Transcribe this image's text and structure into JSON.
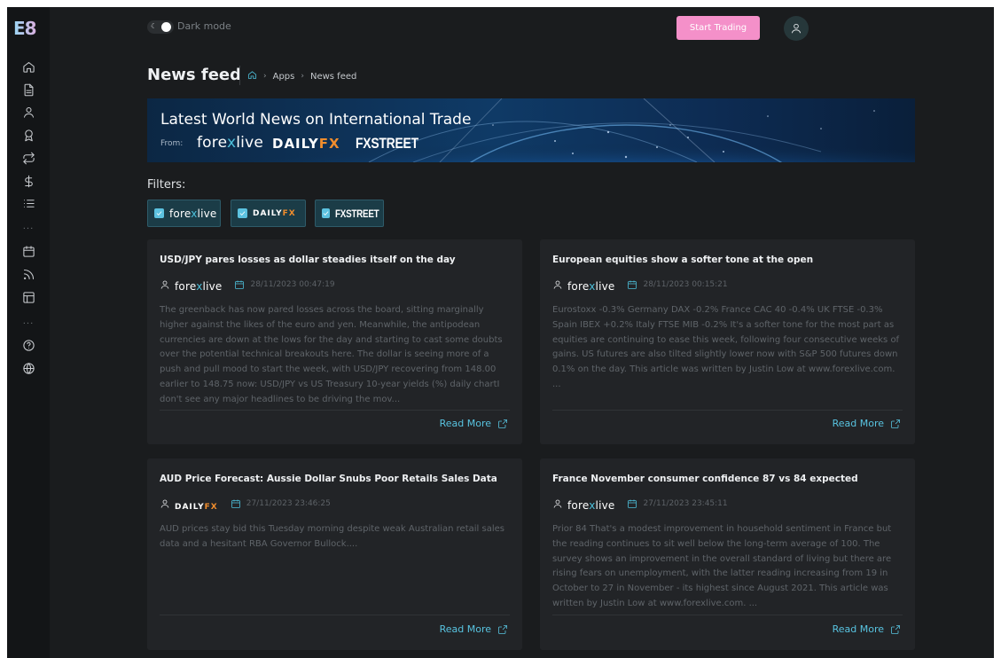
{
  "app": {
    "logo": "E8"
  },
  "topbar": {
    "dark_mode_label": "Dark mode",
    "start_trading_label": "Start Trading"
  },
  "page": {
    "title": "News feed",
    "breadcrumb": [
      "Apps",
      "News feed"
    ]
  },
  "banner": {
    "title": "Latest World News on International Trade",
    "from_label": "From:"
  },
  "sources": {
    "forexlive": {
      "pre": "fore",
      "x": "x",
      "post": "live"
    },
    "dailyfx": {
      "pre": "DAILY",
      "fx": "FX"
    },
    "fxstreet": "FXSTREET"
  },
  "filters": {
    "label": "Filters:",
    "items": [
      {
        "source": "forexlive",
        "checked": true
      },
      {
        "source": "dailyfx",
        "checked": true
      },
      {
        "source": "fxstreet",
        "checked": true
      }
    ]
  },
  "news": [
    {
      "title": "USD/JPY pares losses as dollar steadies itself on the day",
      "source": "forexlive",
      "date": "28/11/2023 00:47:19",
      "body": "The greenback has now pared losses across the board, sitting marginally higher against the likes of the euro and yen. Meanwhile, the antipodean currencies are down at the lows for the day and starting to cast some doubts over the potential technical breakouts here. The dollar is seeing more of a push and pull mood to start the week, with USD/JPY recovering from 148.00 earlier to 148.75 now: USD/JPY vs US Treasury 10-year yields (%) daily chartI don't see any major headlines to be driving the mov...",
      "read_more": "Read More"
    },
    {
      "title": "European equities show a softer tone at the open",
      "source": "forexlive",
      "date": "28/11/2023 00:15:21",
      "body": "Eurostoxx -0.3% Germany DAX -0.2% France CAC 40 -0.4% UK FTSE -0.3% Spain IBEX +0.2% Italy FTSE MIB -0.2% It's a softer tone for the most part as equities are continuing to ease this week, following four consecutive weeks of gains. US futures are also tilted slightly lower now with S&P 500 futures down 0.1% on the day. This article was written by Justin Low at www.forexlive.com. ...",
      "read_more": "Read More"
    },
    {
      "title": "AUD Price Forecast: Aussie Dollar Snubs Poor Retails Sales Data",
      "source": "dailyfx",
      "date": "27/11/2023 23:46:25",
      "body": "AUD prices stay bid this Tuesday morning despite weak Australian retail sales data and a hesitant RBA Governor Bullock....",
      "read_more": "Read More"
    },
    {
      "title": "France November consumer confidence 87 vs 84 expected",
      "source": "forexlive",
      "date": "27/11/2023 23:45:11",
      "body": "Prior 84 That's a modest improvement in household sentiment in France but the reading continues to sit well below the long-term average of 100. The survey shows an improvement in the overall standard of living but there are rising fears on unemployment, with the latter reading increasing from 19 in October to 27 in November - its highest since August 2021. This article was written by Justin Low at www.forexlive.com. ...",
      "read_more": "Read More"
    }
  ],
  "colors": {
    "accent": "#58c3e0",
    "button_pink": "#f490c9",
    "background": "#1a1c1e",
    "card": "#222427",
    "sidebar": "#131517",
    "dailyfx_orange": "#f08d2d"
  },
  "icons": {
    "sidebar": [
      "home-icon",
      "document-icon",
      "user-icon",
      "award-icon",
      "repeat-icon",
      "dollar-icon",
      "list-icon",
      "calendar-icon",
      "rss-icon",
      "layout-icon",
      "help-icon",
      "globe-icon"
    ]
  }
}
